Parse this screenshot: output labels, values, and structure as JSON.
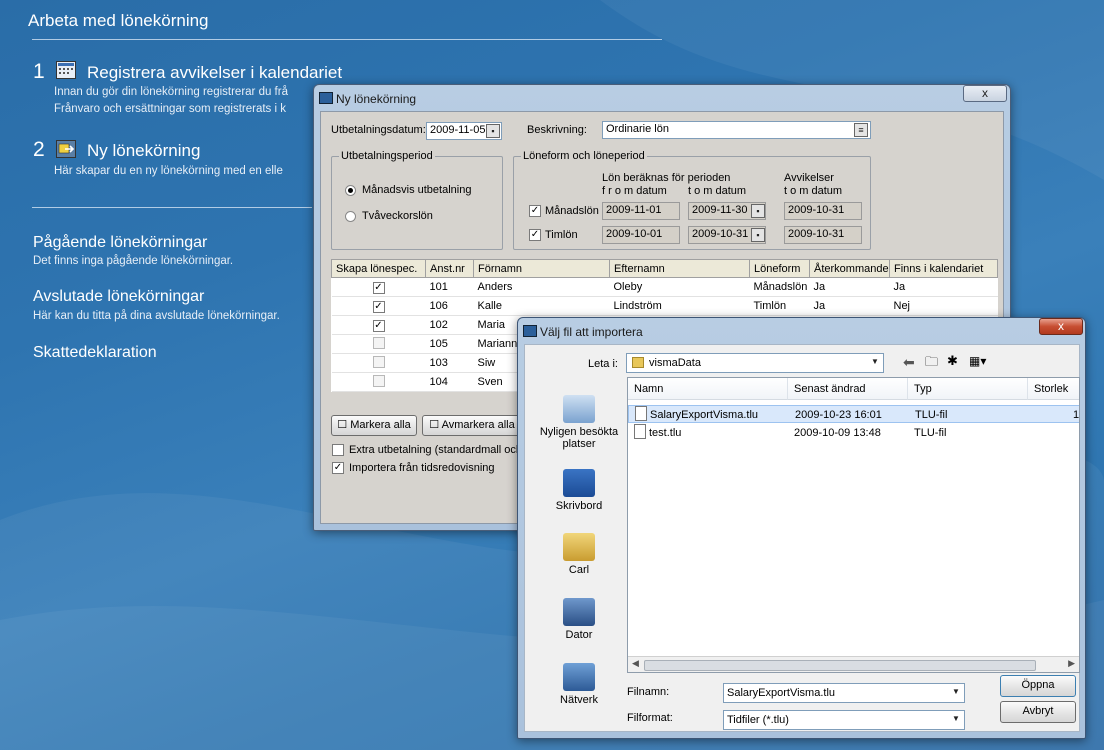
{
  "background": {
    "title": "Arbeta med lönekörning",
    "steps": [
      {
        "number": "1",
        "title": "Registrera avvikelser i kalendariet",
        "desc1": "Innan du gör din lönekörning registrerar du frå",
        "desc2": "Frånvaro och ersättningar som registrerats i k"
      },
      {
        "number": "2",
        "title": "Ny lönekörning",
        "desc1": "Här skapar du en ny lönekörning med en elle"
      }
    ],
    "sections": [
      {
        "title": "Pågående lönekörningar",
        "desc": "Det finns inga pågående lönekörningar."
      },
      {
        "title": "Avslutade lönekörningar",
        "desc": "Här kan du titta på dina avslutade lönekörningar."
      },
      {
        "title": "Skattedeklaration",
        "desc": ""
      }
    ]
  },
  "new_run": {
    "title": "Ny lönekörning",
    "close_label": "x",
    "payment_date_label": "Utbetalningsdatum:",
    "payment_date": "2009-11-05",
    "description_label": "Beskrivning:",
    "description": "Ordinarie lön",
    "period_group": "Utbetalningsperiod",
    "period_options": [
      "Månadsvis utbetalning",
      "Tvåveckorslön"
    ],
    "form_group": "Löneform och löneperiod",
    "calc_header": "Lön beräknas för perioden",
    "from_label": "f r o m datum",
    "to_label": "t o m datum",
    "dev_header": "Avvikelser",
    "dev_to_label": "t o m datum",
    "forms": [
      {
        "label": "Månadslön",
        "from": "2009-11-01",
        "to": "2009-11-30",
        "dev": "2009-10-31"
      },
      {
        "label": "Timlön",
        "from": "2009-10-01",
        "to": "2009-10-31",
        "dev": "2009-10-31"
      }
    ],
    "table": {
      "columns": [
        "Skapa lönespec.",
        "Anst.nr",
        "Förnamn",
        "Efternamn",
        "Löneform",
        "Återkommande",
        "Finns i kalendariet"
      ],
      "rows": [
        {
          "checked": true,
          "nr": "101",
          "first": "Anders",
          "last": "Oleby",
          "form": "Månadslön",
          "rec": "Ja",
          "cal": "Ja"
        },
        {
          "checked": true,
          "nr": "106",
          "first": "Kalle",
          "last": "Lindström",
          "form": "Timlön",
          "rec": "Ja",
          "cal": "Nej"
        },
        {
          "checked": true,
          "nr": "102",
          "first": "Maria",
          "last": "",
          "form": "",
          "rec": "",
          "cal": ""
        },
        {
          "checked": false,
          "nr": "105",
          "first": "Mariann",
          "last": "",
          "form": "",
          "rec": "",
          "cal": ""
        },
        {
          "checked": false,
          "nr": "103",
          "first": "Siw",
          "last": "",
          "form": "",
          "rec": "",
          "cal": ""
        },
        {
          "checked": false,
          "nr": "104",
          "first": "Sven",
          "last": "",
          "form": "",
          "rec": "",
          "cal": ""
        }
      ]
    },
    "mark_all": "Markera alla",
    "unmark_all": "Avmarkera alla",
    "extra_payment": "Extra utbetalning (standardmall och",
    "import_time": "Importera från tidsredovisning"
  },
  "file_dialog": {
    "title": "Välj fil att importera",
    "close_label": "x",
    "look_in_label": "Leta i:",
    "folder": "vismaData",
    "places": [
      "Nyligen besökta platser",
      "Skrivbord",
      "Carl",
      "Dator",
      "Nätverk"
    ],
    "columns": [
      "Namn",
      "Senast ändrad",
      "Typ",
      "Storlek"
    ],
    "files": [
      {
        "name": "SalaryExportVisma.tlu",
        "modified": "2009-10-23 16:01",
        "type": "TLU-fil",
        "size": "1"
      },
      {
        "name": "test.tlu",
        "modified": "2009-10-09 13:48",
        "type": "TLU-fil",
        "size": ""
      }
    ],
    "filename_label": "Filnamn:",
    "filename": "SalaryExportVisma.tlu",
    "format_label": "Filformat:",
    "format": "Tidfiler (*.tlu)",
    "open": "Öppna",
    "cancel": "Avbryt"
  }
}
